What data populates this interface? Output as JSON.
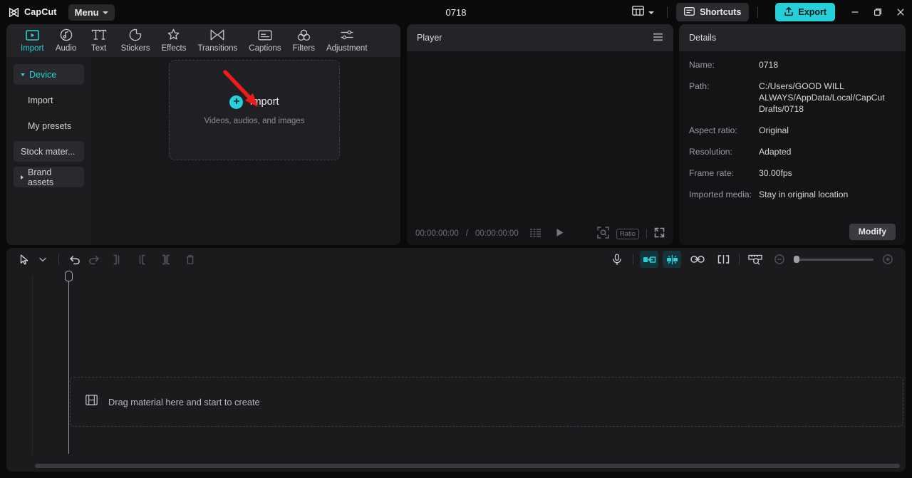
{
  "titlebar": {
    "brand": "CapCut",
    "menu_label": "Menu",
    "project_title": "0718",
    "shortcuts_label": "Shortcuts",
    "export_label": "Export",
    "minimize_tooltip": "Minimize",
    "maximize_tooltip": "Restore",
    "close_tooltip": "Close"
  },
  "tabs": [
    {
      "label": "Import",
      "icon": "import-icon",
      "active": true
    },
    {
      "label": "Audio",
      "icon": "audio-icon",
      "active": false
    },
    {
      "label": "Text",
      "icon": "text-icon",
      "active": false
    },
    {
      "label": "Stickers",
      "icon": "stickers-icon",
      "active": false
    },
    {
      "label": "Effects",
      "icon": "effects-icon",
      "active": false
    },
    {
      "label": "Transitions",
      "icon": "transitions-icon",
      "active": false
    },
    {
      "label": "Captions",
      "icon": "captions-icon",
      "active": false
    },
    {
      "label": "Filters",
      "icon": "filters-icon",
      "active": false
    },
    {
      "label": "Adjustment",
      "icon": "adjustment-icon",
      "active": false
    }
  ],
  "sidebar": {
    "items": [
      {
        "label": "Device",
        "type": "group-expanded"
      },
      {
        "label": "Import",
        "type": "sub"
      },
      {
        "label": "My presets",
        "type": "sub"
      },
      {
        "label": "Stock mater...",
        "type": "group"
      },
      {
        "label": "Brand assets",
        "type": "group-collapsed"
      }
    ]
  },
  "import_dropzone": {
    "title": "Import",
    "subtitle": "Videos, audios, and images",
    "plus_glyph": "+"
  },
  "player": {
    "header": "Player",
    "current_time": "00:00:00:00",
    "separator": "/",
    "total_time": "00:00:00:00",
    "ratio_label": "Ratio"
  },
  "details": {
    "header": "Details",
    "rows": [
      {
        "key": "Name:",
        "value": "0718"
      },
      {
        "key": "Path:",
        "value": "C:/Users/GOOD WILL ALWAYS/AppData/Local/CapCut Drafts/0718"
      },
      {
        "key": "Aspect ratio:",
        "value": "Original"
      },
      {
        "key": "Resolution:",
        "value": "Adapted"
      },
      {
        "key": "Frame rate:",
        "value": "30.00fps"
      },
      {
        "key": "Imported media:",
        "value": "Stay in original location"
      }
    ],
    "modify_label": "Modify"
  },
  "timeline": {
    "drop_hint": "Drag material here and start to create",
    "tools": [
      {
        "name": "select-tool-icon",
        "state": "enabled"
      },
      {
        "name": "chevron-down-icon",
        "state": "enabled"
      },
      {
        "name": "undo-icon",
        "state": "enabled"
      },
      {
        "name": "redo-icon",
        "state": "disabled"
      },
      {
        "name": "split-left-icon",
        "state": "disabled"
      },
      {
        "name": "split-right-icon",
        "state": "disabled"
      },
      {
        "name": "split-icon",
        "state": "disabled"
      },
      {
        "name": "delete-icon",
        "state": "disabled"
      }
    ],
    "right_tools": [
      {
        "name": "microphone-icon",
        "state": "enabled"
      },
      {
        "name": "auto-fit-icon",
        "state": "active"
      },
      {
        "name": "snap-icon",
        "state": "active"
      },
      {
        "name": "link-icon",
        "state": "enabled"
      },
      {
        "name": "cut-clip-icon",
        "state": "enabled"
      },
      {
        "name": "zoom-to-fit-icon",
        "state": "enabled"
      },
      {
        "name": "zoom-out-icon",
        "state": "enabled"
      },
      {
        "name": "zoom-in-icon",
        "state": "enabled"
      }
    ]
  },
  "colors": {
    "accent": "#25d0d8",
    "panel_bg": "#1c1c1f",
    "app_bg": "#0a0a0b",
    "arrow_annotation": "#ee1b1b"
  }
}
